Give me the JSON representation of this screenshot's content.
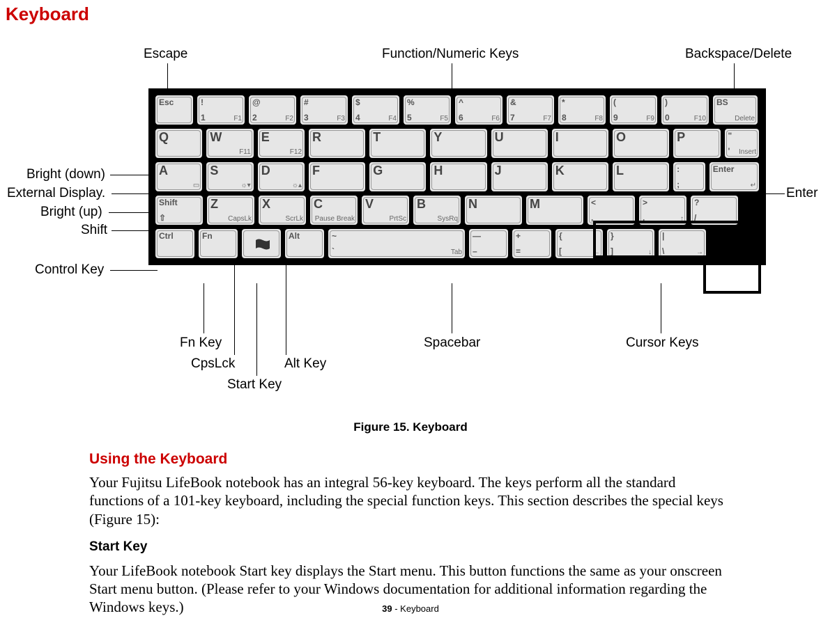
{
  "doc": {
    "title": "Keyboard",
    "figure_caption": "Figure 15.  Keyboard",
    "section_heading": "Using the Keyboard",
    "paragraph1": "Your Fujitsu LifeBook notebook has an integral 56-key keyboard. The keys perform all the standard functions of a 101-key keyboard, including the special function keys. This section describes the special keys (Figure 15):",
    "sub_heading": "Start Key",
    "paragraph2": "Your LifeBook notebook Start key displays the Start menu. This button functions the same as your onscreen Start menu button. (Please refer to your Windows documentation for additional information regarding the Windows keys.)",
    "footer_page": "39",
    "footer_section": " - Keyboard"
  },
  "labels": {
    "escape": "Escape",
    "fnkeys": "Function/Numeric Keys",
    "bsdel": "Backspace/Delete",
    "bright_down": "Bright (down)",
    "ext_disp": "External Display.",
    "bright_up": "Bright (up)",
    "shift": "Shift",
    "ctrl": "Control Key",
    "fnkey": "Fn Key",
    "cpslck": "CpsLck",
    "start": "Start Key",
    "alt": "Alt Key",
    "space": "Spacebar",
    "cursor": "Cursor Keys",
    "enter": "Enter"
  },
  "keys": {
    "row1": [
      {
        "tl": "Esc"
      },
      {
        "tl": "!",
        "bl": "1",
        "sub": "F1"
      },
      {
        "tl": "@",
        "bl": "2",
        "sub": "F2"
      },
      {
        "tl": "#",
        "bl": "3",
        "sub": "F3"
      },
      {
        "tl": "$",
        "bl": "4",
        "sub": "F4"
      },
      {
        "tl": "%",
        "bl": "5",
        "sub": "F5"
      },
      {
        "tl": "^",
        "bl": "6",
        "sub": "F6"
      },
      {
        "tl": "&",
        "bl": "7",
        "sub": "F7"
      },
      {
        "tl": "*",
        "bl": "8",
        "sub": "F8"
      },
      {
        "tl": "(",
        "bl": "9",
        "sub": "F9"
      },
      {
        "tl": ")",
        "bl": "0",
        "sub": "F10"
      },
      {
        "tl": "BS",
        "sub": "Delete"
      }
    ],
    "row2": [
      {
        "main": "Q"
      },
      {
        "main": "W",
        "sub": "F11"
      },
      {
        "main": "E",
        "sub": "F12"
      },
      {
        "main": "R"
      },
      {
        "main": "T"
      },
      {
        "main": "Y"
      },
      {
        "main": "U"
      },
      {
        "main": "I"
      },
      {
        "main": "O"
      },
      {
        "main": "P"
      },
      {
        "tl": "\"",
        "bl": "'",
        "sub": "Insert"
      }
    ],
    "row3": [
      {
        "main": "A",
        "sub": "▭"
      },
      {
        "main": "S",
        "sub": "☼▾"
      },
      {
        "main": "D",
        "sub": "☼▴"
      },
      {
        "main": "F"
      },
      {
        "main": "G"
      },
      {
        "main": "H"
      },
      {
        "main": "J"
      },
      {
        "main": "K"
      },
      {
        "main": "L"
      },
      {
        "tl": ":",
        "bl": ";"
      },
      {
        "tl": "Enter",
        "sub": "↵"
      }
    ],
    "row4": [
      {
        "tl": "Shift",
        "bl": "⇧"
      },
      {
        "main": "Z",
        "sub": "CapsLk"
      },
      {
        "main": "X",
        "sub": "ScrLk"
      },
      {
        "main": "C",
        "sub": "Pause Break"
      },
      {
        "main": "V",
        "sub": "PrtSc"
      },
      {
        "main": "B",
        "sub": "SysRq"
      },
      {
        "main": "N"
      },
      {
        "main": "M"
      },
      {
        "tl": "<",
        "bl": ","
      },
      {
        "tl": ">",
        "bl": ".",
        "sub": "↑"
      },
      {
        "tl": "?",
        "bl": "/"
      }
    ],
    "row5": [
      {
        "tl": "Ctrl"
      },
      {
        "tl": "Fn"
      },
      {
        "win": true
      },
      {
        "tl": "Alt"
      },
      {
        "tl": "~",
        "bl": "`",
        "sub": "Tab"
      },
      {
        "tl": "—",
        "bl": "–"
      },
      {
        "tl": "+",
        "bl": "="
      },
      {
        "tl": "{",
        "bl": "[",
        "sub": "←"
      },
      {
        "tl": "}",
        "bl": "]",
        "sub": "↓"
      },
      {
        "tl": "|",
        "bl": "\\",
        "sub": "→"
      }
    ]
  }
}
